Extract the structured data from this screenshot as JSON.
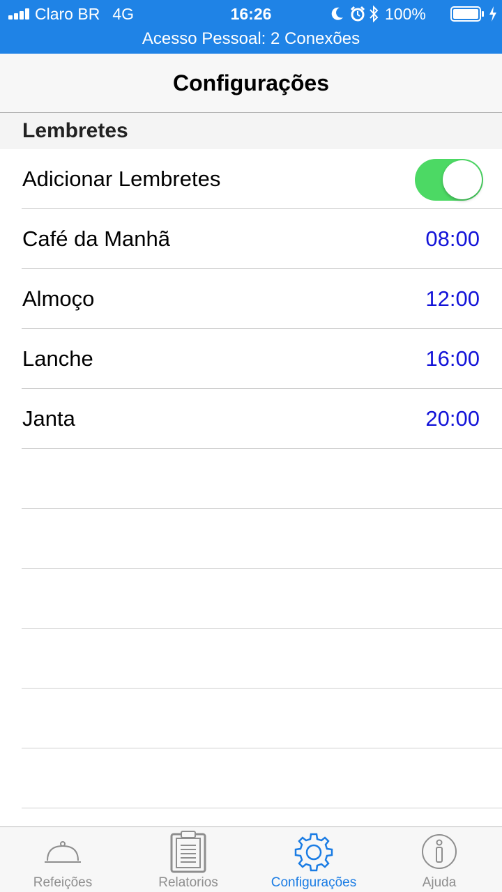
{
  "status_bar": {
    "carrier": "Claro BR",
    "network": "4G",
    "time": "16:26",
    "battery_percent": "100%",
    "hotspot_text": "Acesso Pessoal: 2 Conexões",
    "background_color": "#1f83e6"
  },
  "nav": {
    "title": "Configurações"
  },
  "section": {
    "title": "Lembretes"
  },
  "reminders": {
    "toggle_label": "Adicionar Lembretes",
    "toggle_on": true,
    "meals": [
      {
        "label": "Café da Manhã",
        "time": "08:00"
      },
      {
        "label": "Almoço",
        "time": "12:00"
      },
      {
        "label": "Lanche",
        "time": "16:00"
      },
      {
        "label": "Janta",
        "time": "20:00"
      }
    ]
  },
  "tab_bar": {
    "tabs": [
      {
        "label": "Refeições",
        "icon": "food-cloche-icon",
        "active": false
      },
      {
        "label": "Relatorios",
        "icon": "clipboard-icon",
        "active": false
      },
      {
        "label": "Configurações",
        "icon": "gear-icon",
        "active": true
      },
      {
        "label": "Ajuda",
        "icon": "info-icon",
        "active": false
      }
    ]
  },
  "colors": {
    "accent": "#1a7ce4",
    "time_value": "#1212d8",
    "toggle_on": "#4cd964",
    "tab_inactive": "#8e8e8e"
  }
}
